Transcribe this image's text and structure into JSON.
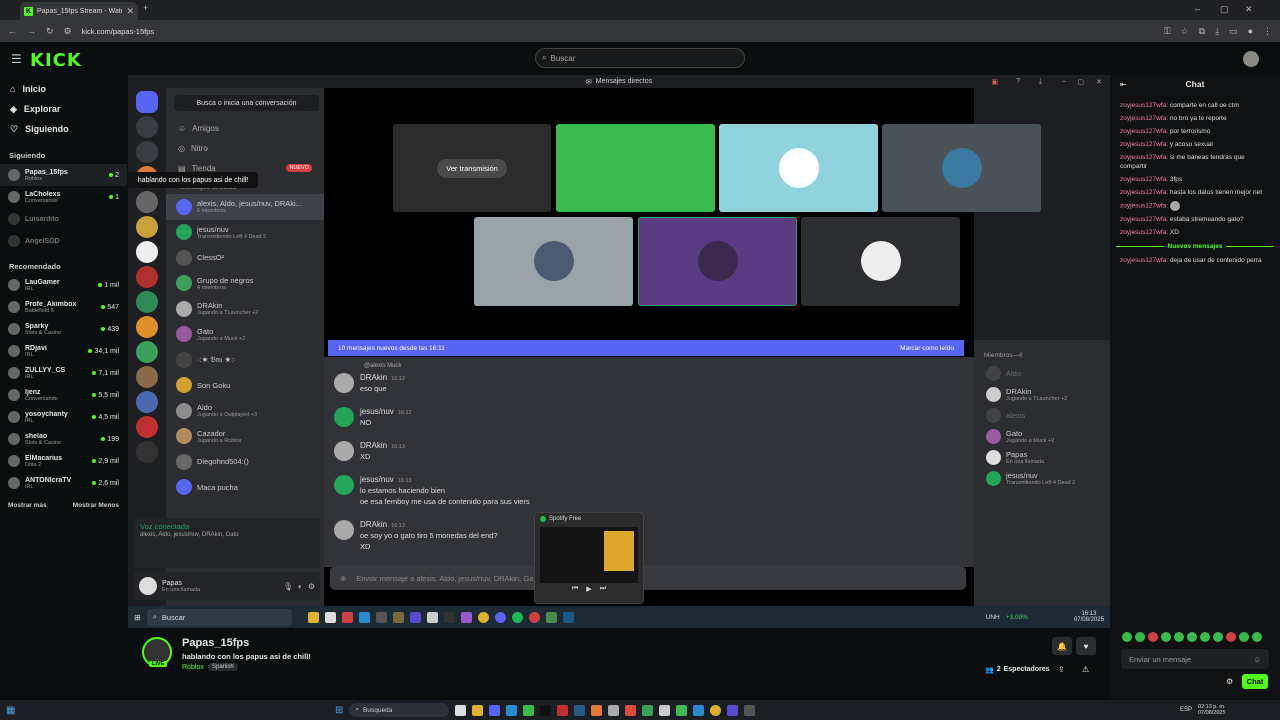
{
  "browser": {
    "tab_title": "Papas_15fps Stream - Watch Li",
    "url": "kick.com/papas-15fps",
    "win_controls": [
      "–",
      "▢",
      "✕"
    ]
  },
  "header": {
    "logo": "KICK",
    "search_placeholder": "Buscar"
  },
  "sidebar": {
    "nav": [
      {
        "label": "Inicio",
        "icon": "home-icon"
      },
      {
        "label": "Explorar",
        "icon": "compass-icon"
      },
      {
        "label": "Siguiendo",
        "icon": "heart-icon"
      }
    ],
    "following_title": "Siguiendo",
    "following": [
      {
        "name": "Papas_15fps",
        "game": "Roblox",
        "viewers": "2",
        "live": true
      },
      {
        "name": "LaCholexs",
        "game": "Conversando",
        "viewers": "1",
        "live": true
      },
      {
        "name": "Luisardito",
        "game": "",
        "viewers": "",
        "live": false
      },
      {
        "name": "AngelSOD",
        "game": "",
        "viewers": "",
        "live": false
      }
    ],
    "recommended_title": "Recomendado",
    "recommended": [
      {
        "name": "LauGamer",
        "game": "IRL",
        "viewers": "1 mil"
      },
      {
        "name": "Profe_Akimbox",
        "game": "Battlefield 6",
        "viewers": "547"
      },
      {
        "name": "Sparky",
        "game": "Slots & Casino",
        "viewers": "439"
      },
      {
        "name": "RDjavi",
        "game": "IRL",
        "viewers": "34,1 mil"
      },
      {
        "name": "ZULLYY_CS",
        "game": "IRL",
        "viewers": "7,1 mil"
      },
      {
        "name": "ljenz",
        "game": "Conversando",
        "viewers": "5,5 mil"
      },
      {
        "name": "yosoychanty",
        "game": "IRL",
        "viewers": "4,5 mil"
      },
      {
        "name": "shelao",
        "game": "Slots & Casino",
        "viewers": "199"
      },
      {
        "name": "ElMacarius",
        "game": "Dota 2",
        "viewers": "2,9 mil"
      },
      {
        "name": "ANTONIcraTV",
        "game": "IRL",
        "viewers": "2,6 mil"
      }
    ],
    "show_more": "Mostrar más",
    "show_less": "Mostrar Menos",
    "tooltip": "hablando con los papus asi de chill!"
  },
  "discord": {
    "title": "Mensajes directos",
    "search": "Busca o inicia una conversación",
    "nav": [
      {
        "label": "Amigos"
      },
      {
        "label": "Nitro"
      },
      {
        "label": "Tienda"
      }
    ],
    "new_badge": "NUEVO",
    "dm_header": "Mensajes directos",
    "dms": [
      {
        "name": "alexis, Aldo, jesus/nuv, DRAki...",
        "status": "6 miembros"
      },
      {
        "name": "jesus/nuv",
        "status": "Transmitiendo Left 4 Dead 2"
      },
      {
        "name": "ClessO²",
        "status": ""
      },
      {
        "name": "Grupo de negros",
        "status": "4 miembros"
      },
      {
        "name": "DRAkin",
        "status": "Jugando a TLauncher +2"
      },
      {
        "name": "Gato",
        "status": "Jugando a Muck +2"
      },
      {
        "name": "·:★ 𝔅𝔬𝔶 ★:·",
        "status": ""
      },
      {
        "name": "Son Goku",
        "status": ""
      },
      {
        "name": "Aldo",
        "status": "Jugando a Outplayed +3"
      },
      {
        "name": "Cazador",
        "status": "Jugando a Roblox"
      },
      {
        "name": "Diegohnd504:()",
        "status": ""
      },
      {
        "name": "Maca pucha",
        "status": ""
      }
    ],
    "voice_title": "Voz conectada",
    "voice_members": "alexis, Aldo, jesus/nuv, DRAkin, Gato",
    "user_name": "Papas",
    "user_status": "En una llamada",
    "watch_stream": "Ver transmisión",
    "banner_text": "10 mensajes nuevos desde las 16:11",
    "banner_action": "Marcar como leído",
    "reply_context": "@alexis  Muck",
    "messages": [
      {
        "author": "DRAkin",
        "time": "16:12",
        "text": "eso que"
      },
      {
        "author": "jesus/nuv",
        "time": "16:12",
        "text": "NO"
      },
      {
        "author": "DRAkin",
        "time": "16:13",
        "text": "XD"
      },
      {
        "author": "jesus/nuv",
        "time": "16:13",
        "text": "lo estamos haciendo bien"
      },
      {
        "author": "",
        "time": "",
        "text": "oe esa femboy me usa de contenido para sus viers"
      },
      {
        "author": "DRAkin",
        "time": "16:13",
        "text": "oe soy yo o gato tiro 5 monedas del end?"
      },
      {
        "author": "",
        "time": "",
        "text": "XD"
      }
    ],
    "input_placeholder": "Enviar mensaje a alexis, Aldo, jesus/nuv, DRAkin, Ga",
    "members_title": "Miembros—6",
    "members": [
      {
        "name": "Aldo",
        "status": ""
      },
      {
        "name": "DRAkin",
        "status": "Jugando a TLauncher +2"
      },
      {
        "name": "alexis",
        "status": ""
      },
      {
        "name": "Gato",
        "status": "Jugando a Muck +2"
      },
      {
        "name": "Papas",
        "status": "En una llamada"
      },
      {
        "name": "jesus/nuv",
        "status": "Transmitiendo Left 4 Dead 2"
      }
    ],
    "spotify_title": "Spotify Free",
    "win_search": "Buscar",
    "stock": "UNH",
    "stock_change": "+3,09%",
    "time": "16:13",
    "date": "07/08/2025"
  },
  "stream": {
    "channel": "Papas_15fps",
    "live_badge": "LIVE",
    "title": "hablando con los papus asi de chill!",
    "game": "Roblox",
    "language": "Spanish",
    "viewers_count": "2",
    "viewers_label": "Espectadores"
  },
  "chat": {
    "title": "Chat",
    "messages": [
      {
        "user": "zoyjesus127wfa:",
        "text": "comparte en call oe ctm"
      },
      {
        "user": "zoyjesus127wfa:",
        "text": "no bro ya te reporte"
      },
      {
        "user": "zoyjesus127wfa:",
        "text": "por terrorismo"
      },
      {
        "user": "zoyjesus127wfa:",
        "text": "y acoso sexual"
      },
      {
        "user": "zoyjesus127wfa:",
        "text": "si me baneas tendras que compartir"
      },
      {
        "user": "zoyjesus127wfa:",
        "text": "3fps"
      },
      {
        "user": "zoyjesus127wfa:",
        "text": "hasta los datos tienen mejor net"
      },
      {
        "user": "zoyjesus127wfa:",
        "text": ""
      },
      {
        "user": "zoyjesus127wfa:",
        "text": "estaba stremeando gato?"
      },
      {
        "user": "zoyjesus127wfa:",
        "text": "XD"
      }
    ],
    "new_messages": "Nuevos mensajes",
    "after": [
      {
        "user": "zoyjesus127wfa:",
        "text": "deja de usar de contenido perra"
      }
    ],
    "input_placeholder": "Enviar un mensaje",
    "send_label": "Chat"
  },
  "os": {
    "search": "Busqueda",
    "lang": "ESP",
    "time": "02:13 p. m.",
    "date": "07/08/2025"
  }
}
